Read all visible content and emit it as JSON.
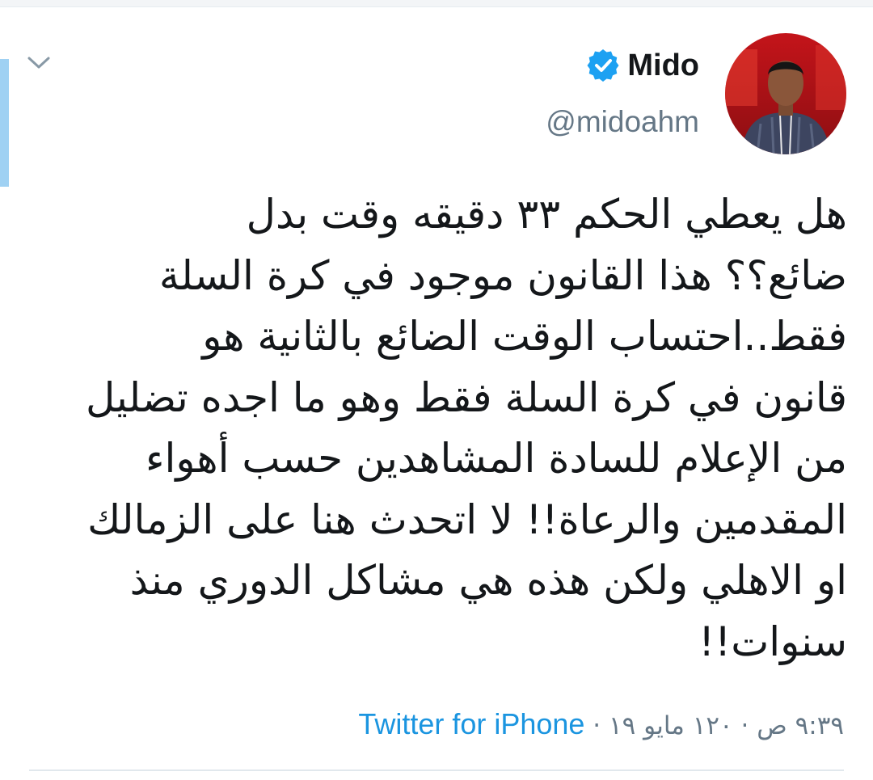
{
  "tweet": {
    "author": {
      "display_name": "Mido",
      "handle": "@midoahm",
      "verified": true
    },
    "text_lines": [
      "هل يعطي الحكم ٣٣ دقيقه وقت بدل",
      "ضائع؟؟ هذا القانون موجود في كرة السلة",
      "فقط..احتساب الوقت الضائع بالثانية هو",
      "قانون في كرة السلة فقط وهو ما اجده تضليل",
      "من الإعلام للسادة المشاهدين حسب أهواء",
      "المقدمين والرعاة!! لا اتحدث هنا على الزمالك",
      "او الاهلي ولكن هذه هي مشاكل الدوري منذ",
      "سنوات!!"
    ],
    "timestamp": "٩:٣٩ ص · ١٢٠ مايو ١٩",
    "separator": "·",
    "source": "Twitter for iPhone"
  },
  "icons": {
    "verified": "verified-badge-icon",
    "caret": "chevron-down-icon"
  },
  "colors": {
    "accent": "#1da1f2",
    "link": "#1b95e0",
    "text": "#14171a",
    "muted": "#657786",
    "thread_marker": "#9fd1f3"
  }
}
